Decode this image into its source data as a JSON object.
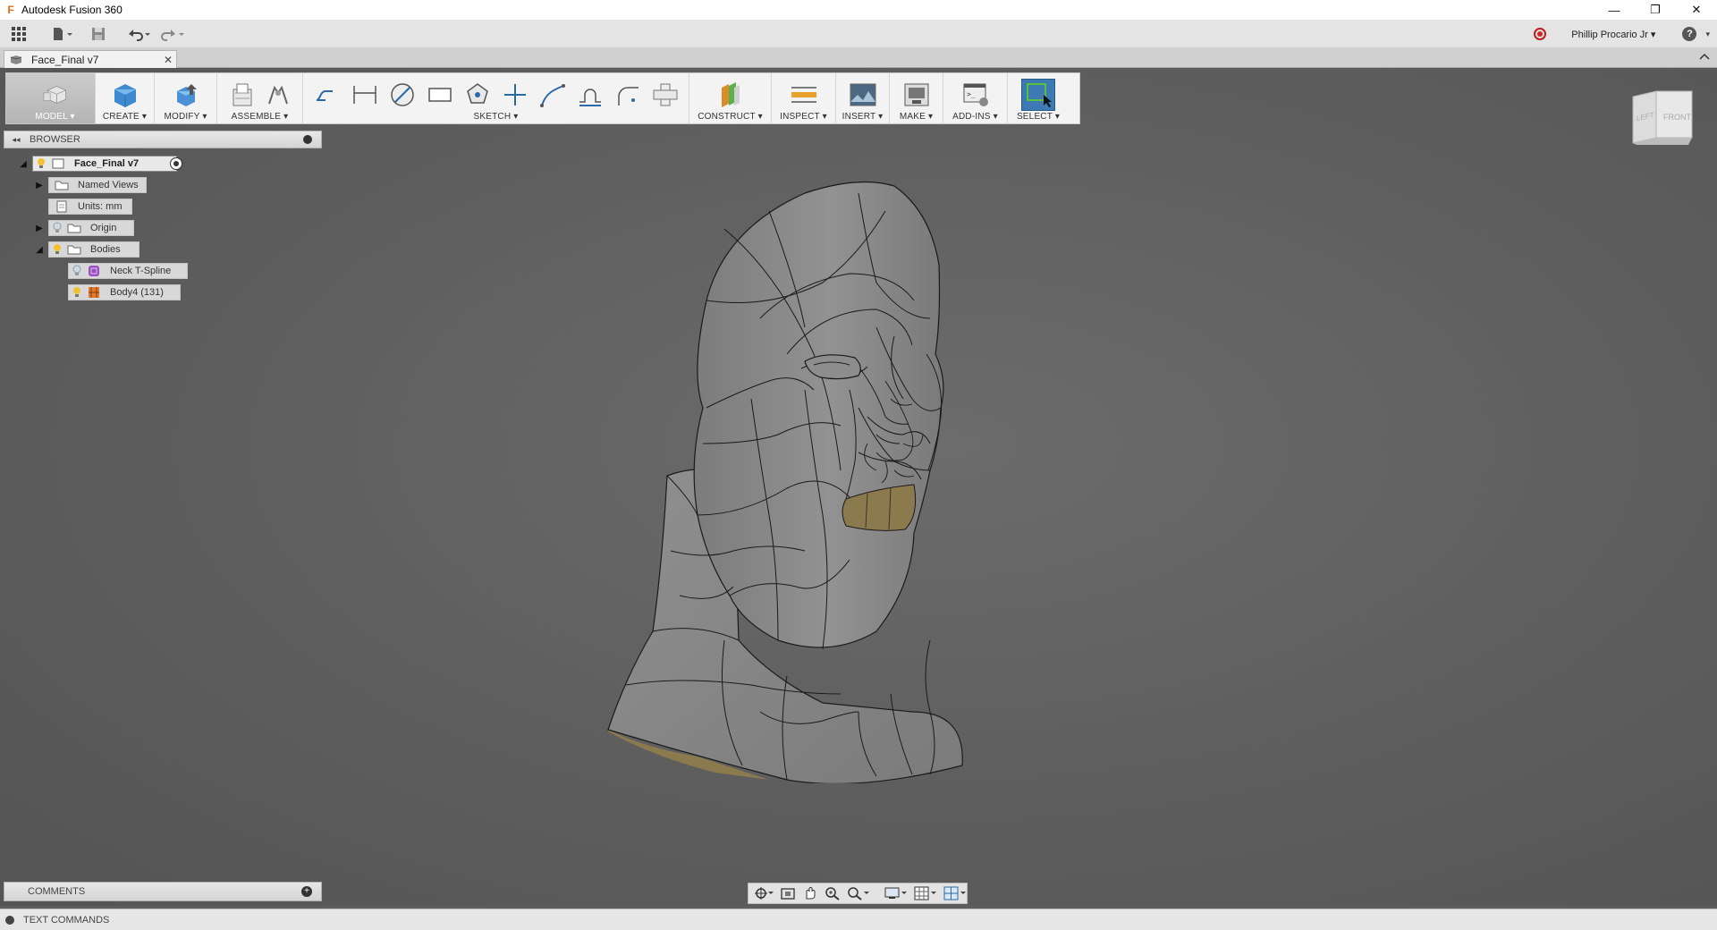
{
  "window": {
    "title": "Autodesk Fusion 360",
    "minimize": "—",
    "restore": "❐",
    "close": "✕"
  },
  "quick_access": {
    "user_name": "Phillip Procario Jr ▾",
    "help": "?"
  },
  "document_tab": {
    "label": "Face_Final v7",
    "close": "✕"
  },
  "toolbar": {
    "groups": {
      "model": "MODEL ▾",
      "create": "CREATE ▾",
      "modify": "MODIFY ▾",
      "assemble": "ASSEMBLE ▾",
      "sketch": "SKETCH ▾",
      "construct": "CONSTRUCT ▾",
      "inspect": "INSPECT ▾",
      "insert": "INSERT ▾",
      "make": "MAKE ▾",
      "addins": "ADD-INS ▾",
      "select": "SELECT ▾"
    }
  },
  "browser": {
    "title": "BROWSER",
    "items": [
      {
        "label": "Face_Final v7"
      },
      {
        "label": "Named Views"
      },
      {
        "label": "Units: mm"
      },
      {
        "label": "Origin"
      },
      {
        "label": "Bodies"
      },
      {
        "label": "Neck T-Spline"
      },
      {
        "label": "Body4 (131)"
      }
    ]
  },
  "viewcube": {
    "left": "LEFT",
    "front": "FRONT"
  },
  "comments": {
    "label": "COMMENTS"
  },
  "text_commands": {
    "label": "TEXT COMMANDS"
  },
  "colors": {
    "select_active": "#3d7ab3",
    "model_surface": "#8a8a8a",
    "mouth_body": "#8c7a4f",
    "tspline_icon": "#9b4fc1",
    "body_icon": "#e07a2a",
    "bulb": "#f2c233"
  }
}
